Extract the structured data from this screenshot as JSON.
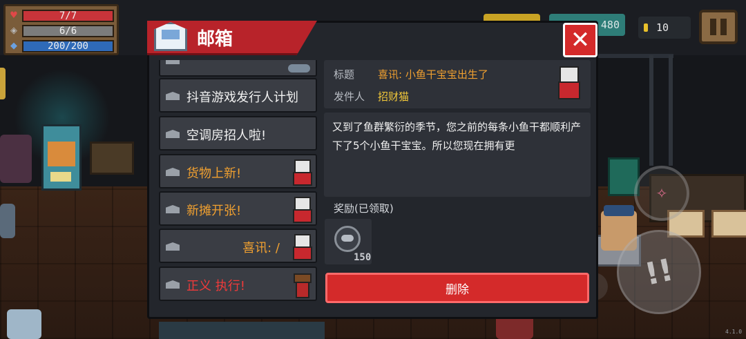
{
  "hud": {
    "hp": "7/7",
    "armor": "6/6",
    "energy": "200/200"
  },
  "topbar": {
    "currency_value": "480",
    "coin_value": "10"
  },
  "dialog": {
    "title": "邮箱",
    "close_label": "✕"
  },
  "mail_list": [
    {
      "subject": "抖音游戏发行人计划",
      "color": "white",
      "sender_icon": "none"
    },
    {
      "subject": "空调房招人啦!",
      "color": "white",
      "sender_icon": "none"
    },
    {
      "subject": "货物上新!",
      "color": "orange",
      "sender_icon": "cat-icon"
    },
    {
      "subject": "新摊开张!",
      "color": "orange",
      "sender_icon": "cat-icon"
    },
    {
      "subject": "喜讯: /",
      "color": "orange",
      "sender_icon": "cat-icon"
    },
    {
      "subject": "正义 执行!",
      "color": "red",
      "sender_icon": "cup-icon"
    }
  ],
  "detail": {
    "title_label": "标题",
    "title_value": "喜讯: 小鱼干宝宝出生了",
    "sender_label": "发件人",
    "sender_value": "招财猫",
    "body": "又到了鱼群繁衍的季节，您之前的每条小鱼干都顺利产下了5个小鱼干宝宝。所以您现在拥有更",
    "reward_label": "奖励(已领取)",
    "reward_quantity": "150",
    "delete_label": "删除"
  },
  "footer": {
    "version": "4.1.0"
  },
  "colors": {
    "accent_red": "#d42a2a",
    "mail_orange": "#f0a030",
    "mail_red": "#f03a3a",
    "sender_yellow": "#f3c93a"
  }
}
